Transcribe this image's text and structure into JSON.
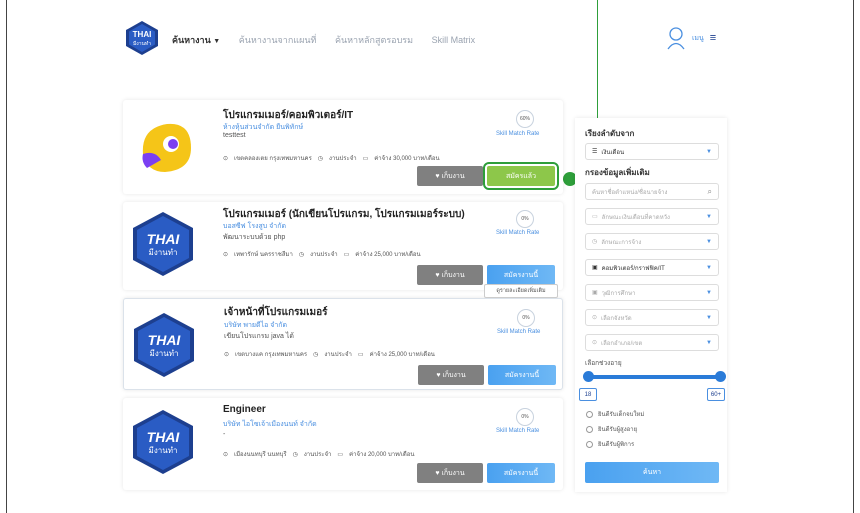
{
  "header": {
    "logo_top": "THAI",
    "logo_bottom": "มีงานทำ",
    "nav": [
      {
        "label": "ค้นหางาน",
        "active": true
      },
      {
        "label": "ค้นหางานจากแผนที่",
        "active": false
      },
      {
        "label": "ค้นหาหลักสูตรอบรม",
        "active": false
      },
      {
        "label": "Skill Matrix",
        "active": false
      }
    ],
    "menu_label": "เมนู"
  },
  "jobs": [
    {
      "title": "โปรแกรมเมอร์/คอมพิวเตอร์/IT",
      "company": "ห้างหุ้นส่วนจำกัด ยืนพิทักษ์",
      "desc": "testtest",
      "location": "เขตคลองเตย กรุงเทพมหานคร",
      "type": "งานประจำ",
      "wage": "ค่าจ้าง 30,000 บาท/เดือน",
      "match": "60%",
      "save": "เก็บงาน",
      "apply": "สมัครแล้ว",
      "applied": true
    },
    {
      "title": "โปรแกรมเมอร์ (นักเขียนโปรแกรม, โปรแกรมเมอร์ระบบ)",
      "company": "บอสซีฟ โรงสูบ จำกัด",
      "desc": "พัฒนาระบบด้วย php",
      "location": "เทพารักษ์ นครราชสีมา",
      "type": "งานประจำ",
      "wage": "ค่าจ้าง 25,000 บาท/เดือน",
      "match": "0%",
      "save": "เก็บงาน",
      "apply": "สมัครงานนี้",
      "applied": false
    },
    {
      "title": "เจ้าหน้าที่โปรแกรมเมอร์",
      "company": "บริษัท พายดีไอ จำกัด",
      "desc": "เขียนโปรแกรม java ได้",
      "location": "เขตบางแค กรุงเทพมหานคร",
      "type": "งานประจำ",
      "wage": "ค่าจ้าง 25,000 บาท/เดือน",
      "match": "0%",
      "save": "เก็บงาน",
      "apply": "สมัครงานนี้",
      "applied": false
    },
    {
      "title": "Engineer",
      "company": "บริษัท ไอโซเจ้าเมืองนนท์ จำกัด",
      "desc": "-",
      "location": "เมืองนนทบุรี นนทบุรี",
      "type": "งานประจำ",
      "wage": "ค่าจ้าง 20,000 บาท/เดือน",
      "match": "0%",
      "save": "เก็บงาน",
      "apply": "สมัครงานนี้",
      "applied": false
    }
  ],
  "match_label": "Skill Match Rate",
  "tooltip": "ดูรายละเอียดเพิ่มเติม",
  "thai_logo": {
    "top": "THAI",
    "bottom": "มีงานทำ"
  },
  "filters": {
    "sort_title": "เรียงลำดับจาก",
    "sort_value": "เงินเดือน",
    "more_title": "กรองข้อมูลเพิ่มเติม",
    "search_placeholder": "ค้นหาชื่อตำแหน่ง/ชื่อนายจ้าง",
    "selects": [
      "ลักษณะเงินเดือนที่คาดหวัง",
      "ลักษณะการจ้าง",
      "คอมพิวเตอร์/กราฟฟิค/IT",
      "วุฒิการศึกษา",
      "เลือกจังหวัด",
      "เลือกอำเภอ/เขต"
    ],
    "age_label": "เลือกช่วงอายุ",
    "age_min": "18",
    "age_max": "60+",
    "radios": [
      "ยินดีรับเด็กจบใหม่",
      "ยินดีรับผู้สูงอายุ",
      "ยินดีรับผู้พิการ"
    ],
    "search_button": "ค้นหา"
  },
  "colors": {
    "accent": "#4aa1f0",
    "applied": "#8dc74a",
    "callout": "#2e9e3a"
  }
}
